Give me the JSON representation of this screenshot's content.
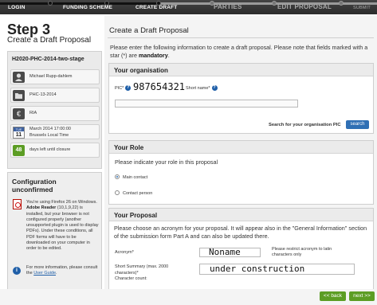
{
  "wizard": {
    "steps": [
      "LOGIN",
      "FUNDING SCHEME",
      "CREATE DRAFT",
      "PARTIES",
      "EDIT PROPOSAL",
      "SUBMIT"
    ]
  },
  "sidebar": {
    "step_title": "Step 3",
    "step_subtitle": "Create a Draft Proposal",
    "call_id": "H2020-PHC-2014-two-stage",
    "rows": [
      {
        "icon": "user-icon",
        "text": "Michael Rupp-dahlem"
      },
      {
        "icon": "folder-icon",
        "text": "PHC-13-2014"
      },
      {
        "icon": "euro-icon",
        "text": "RIA"
      },
      {
        "icon": "calendar-icon",
        "cal_month": "TUE",
        "cal_day": "11",
        "line1": "March 2014 17:00:00",
        "line2": "Brussels Local Time"
      },
      {
        "icon": "days-left-badge",
        "badge": "48",
        "text": "days left until closure"
      }
    ],
    "config": {
      "title_line1": "Configuration",
      "title_line2": "unconfirmed",
      "text_a": "You're using Firefox 26 on Windows. ",
      "text_b": "Adobe Reader",
      "text_c": " (10,1,9,22) is installed, but your browser is not configured properly (another unsupported plugin is used to display PDFs). Under these conditions, all PDF forms will have to be downloaded on your computer in order to be edited.",
      "more_prefix": "For more information, please consult the ",
      "more_link": "User Guide",
      "more_suffix": "."
    }
  },
  "main": {
    "title": "Create a Draft Proposal",
    "intro_a": "Please enter the following information to create a draft proposal. Please note that fields marked with a star (*) are ",
    "intro_b": "mandatory",
    "intro_c": ".",
    "organisation": {
      "heading": "Your organisation",
      "pic_label": "PIC*",
      "pic_value": "987654321",
      "short_name_label": "Short name*",
      "search_label": "Search for your organisation PIC",
      "search_button": "search"
    },
    "role": {
      "heading": "Your Role",
      "prompt": "Please indicate your role in this proposal",
      "options": [
        "Main contact",
        "Contact person"
      ],
      "selected": "Main contact"
    },
    "proposal": {
      "heading": "Your Proposal",
      "intro": "Please choose an acronym for your proposal. It will appear also in the \"General Information\" section of the submission form Part A and can also be updated there.",
      "acronym_label": "Acronym*",
      "acronym_value": "Noname",
      "acronym_hint": "Please restrict acronym to latin characters only",
      "summary_label_1": "Short Summary (max. 2000",
      "summary_label_2": "characters)*",
      "char_count_label": "Character count:",
      "summary_value": "under construction"
    }
  },
  "footer": {
    "back": "<< back",
    "next": "next >>"
  }
}
